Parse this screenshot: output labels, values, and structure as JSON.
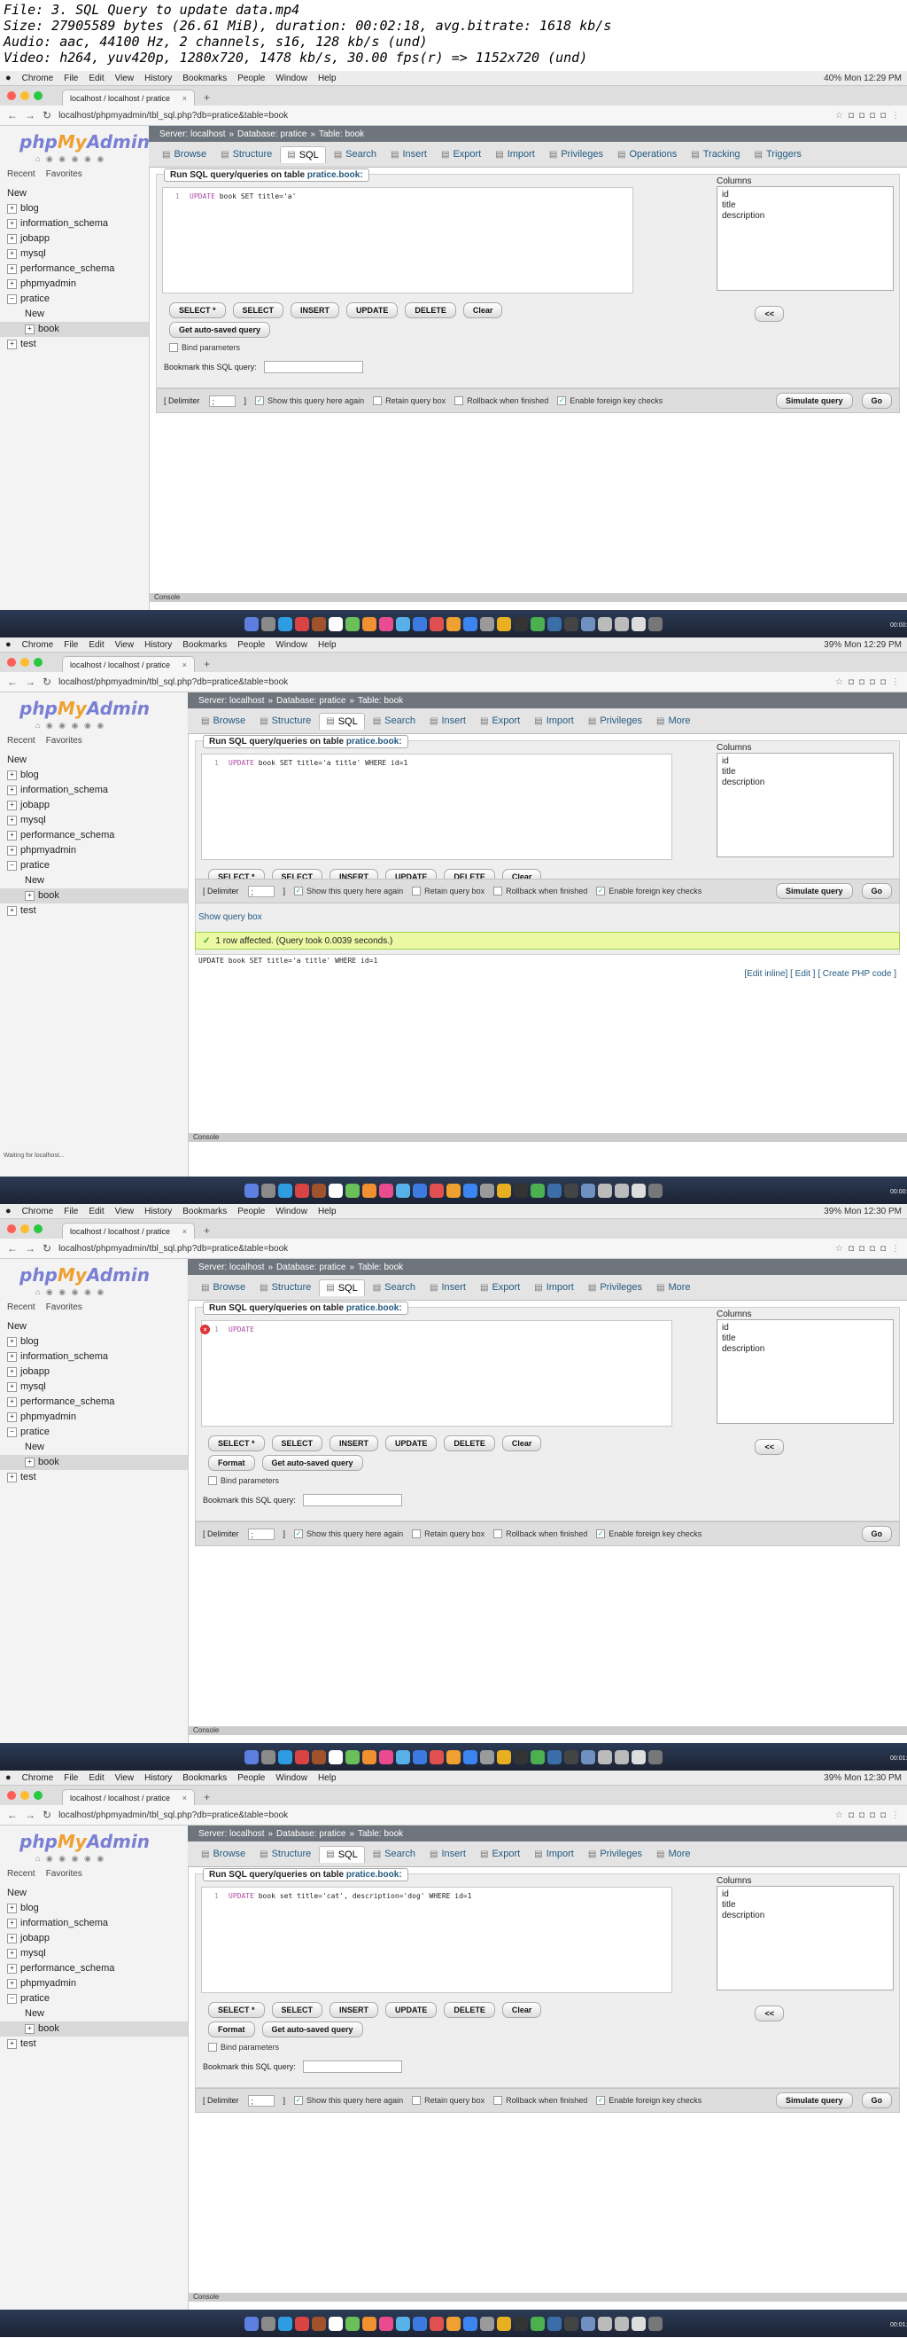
{
  "header": {
    "line1": "File: 3. SQL Query to update data.mp4",
    "line2": "Size: 27905589 bytes (26.61 MiB), duration: 00:02:18, avg.bitrate: 1618 kb/s",
    "line3": "Audio: aac, 44100 Hz, 2 channels, s16, 128 kb/s (und)",
    "line4": "Video: h264, yuv420p, 1280x720, 1478 kb/s, 30.00 fps(r) => 1152x720 (und)"
  },
  "mac_menu": {
    "apple": "",
    "chrome": "Chrome",
    "file": "File",
    "edit": "Edit",
    "view": "View",
    "history": "History",
    "bookmarks": "Bookmarks",
    "people": "People",
    "window": "Window",
    "help": "Help"
  },
  "browser": {
    "tab_title": "localhost / localhost / pratice",
    "url": "localhost/phpmyadmin/tbl_sql.php?db=pratice&table=book"
  },
  "pma": {
    "logo_php": "php",
    "logo_my": "My",
    "logo_admin": "Admin",
    "recent": "Recent",
    "favorites": "Favorites",
    "tree": [
      "New",
      "blog",
      "information_schema",
      "jobapp",
      "mysql",
      "performance_schema",
      "phpmyadmin",
      "pratice",
      "New",
      "book",
      "test"
    ],
    "breadcrumb": {
      "server": "Server: localhost",
      "database": "Database: pratice",
      "table": "Table: book"
    },
    "tabs": [
      "Browse",
      "Structure",
      "SQL",
      "Search",
      "Insert",
      "Export",
      "Import",
      "Privileges",
      "More"
    ],
    "tabs_wide": [
      "Browse",
      "Structure",
      "SQL",
      "Search",
      "Insert",
      "Export",
      "Import",
      "Privileges",
      "Operations",
      "Tracking",
      "Triggers"
    ],
    "legend_prefix": "Run SQL query/queries on table",
    "legend_db": "pratice.book:",
    "columns_label": "Columns",
    "columns": [
      "id",
      "title",
      "description"
    ],
    "buttons": [
      "SELECT *",
      "SELECT",
      "INSERT",
      "UPDATE",
      "DELETE",
      "Clear"
    ],
    "format": "Format",
    "auto_saved": "Get auto-saved query",
    "bind_params": "Bind parameters",
    "bookmark": "Bookmark this SQL query:",
    "less": "<<",
    "delimiter": "[ Delimiter",
    "delimiter_value": ";",
    "delimiter_close": "]",
    "show_again": "Show this query here again",
    "retain": "Retain query box",
    "rollback": "Rollback when finished",
    "foreign": "Enable foreign key checks",
    "simulate": "Simulate query",
    "go": "Go",
    "show_query_box": "Show query box",
    "success": "1 row affected. (Query took 0.0039 seconds.)",
    "edit_links": "[Edit inline] [ Edit ] [ Create PHP code ]",
    "console": "Console",
    "status": "Waiting for localhost..."
  },
  "frames": [
    {
      "time": "Mon 12:29 PM",
      "battery": "40%",
      "query_kw": "UPDATE",
      "query_rest": "book SET title='a'",
      "echo": "",
      "timestamp": "00:00:28"
    },
    {
      "time": "Mon 12:29 PM",
      "battery": "39%",
      "query_kw": "UPDATE",
      "query_rest": "book SET title='a title' WHERE id=1",
      "echo": "UPDATE book SET title='a title' WHERE id=1",
      "timestamp": "00:00:56"
    },
    {
      "time": "Mon 12:30 PM",
      "battery": "39%",
      "query_kw": "UPDATE",
      "query_rest": "",
      "echo": "",
      "timestamp": "00:01:22"
    },
    {
      "time": "Mon 12:30 PM",
      "battery": "39%",
      "query_kw": "UPDATE",
      "query_rest": "book set title='cat', description='dog' WHERE id=1",
      "echo": "",
      "timestamp": "00:01:50"
    }
  ]
}
